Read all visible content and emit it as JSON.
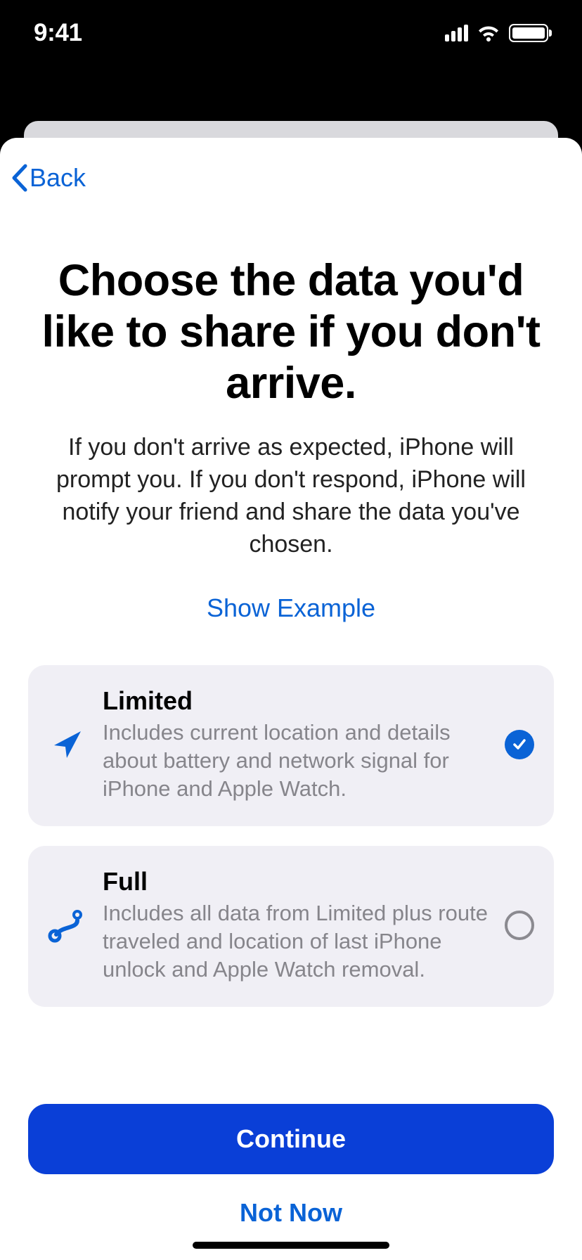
{
  "status": {
    "time": "9:41"
  },
  "nav": {
    "back": "Back"
  },
  "title": "Choose the data you'd like to share if you don't arrive.",
  "subtitle": "If you don't arrive as expected, iPhone will prompt you. If you don't respond, iPhone will notify your friend and share the data you've chosen.",
  "show_example": "Show Example",
  "options": [
    {
      "id": "limited",
      "title": "Limited",
      "desc": "Includes current location and details about battery and network signal for iPhone and Apple Watch.",
      "selected": true,
      "icon": "location-arrow-icon"
    },
    {
      "id": "full",
      "title": "Full",
      "desc": "Includes all data from Limited plus route traveled and location of last iPhone unlock and Apple Watch removal.",
      "selected": false,
      "icon": "route-pin-icon"
    }
  ],
  "footer": {
    "continue": "Continue",
    "not_now": "Not Now"
  },
  "colors": {
    "accent_blue": "#0a63d6",
    "button_blue": "#0a3fd7",
    "card_bg": "#f0eff5",
    "desc_gray": "#86858b"
  }
}
